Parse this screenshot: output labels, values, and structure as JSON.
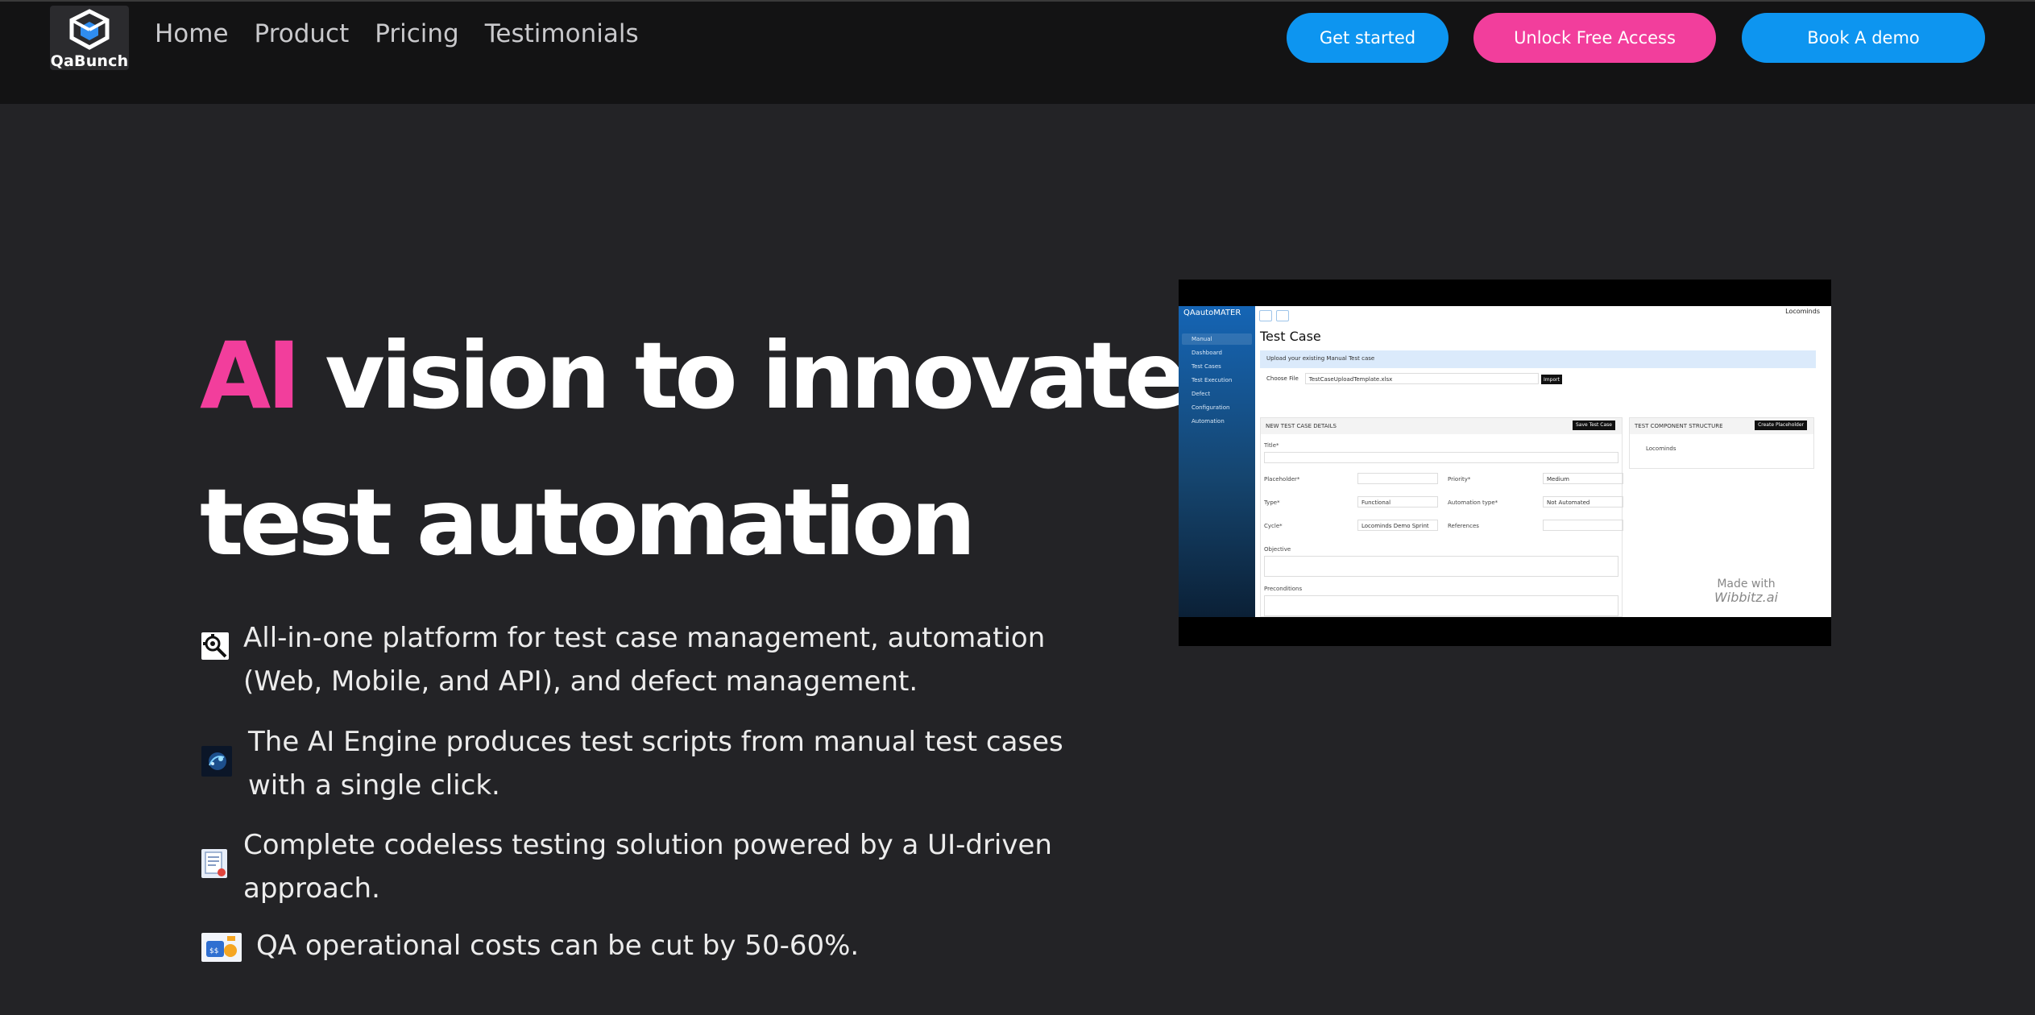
{
  "nav": {
    "logo_text": "QaBunch",
    "links": [
      "Home",
      "Product",
      "Pricing",
      "Testimonials"
    ],
    "buttons": {
      "get_started": "Get started",
      "unlock": "Unlock Free Access",
      "book_demo": "Book A demo"
    }
  },
  "hero": {
    "title_accent": "AI",
    "title_rest": " vision to innovate",
    "title_line2": "test automation"
  },
  "features": [
    {
      "icon": "gear-search-icon",
      "text": "All-in-one platform for test case management, automation (Web, Mobile, and API), and defect management."
    },
    {
      "icon": "ai-brain-icon",
      "text": "The AI Engine produces test scripts from manual test cases with a single click."
    },
    {
      "icon": "codeless-doc-icon",
      "text": "Complete codeless testing solution powered by a UI-driven approach."
    },
    {
      "icon": "cost-savings-icon",
      "text": "QA operational costs can be cut by 50-60%."
    }
  ],
  "preview": {
    "brand": "QAautoMATER",
    "user": "Locominds",
    "sidebar": [
      "Manual",
      "Dashboard",
      "Test Cases",
      "Test Execution",
      "Defect",
      "Configuration",
      "Automation"
    ],
    "page_title": "Test Case",
    "upload_label": "Upload your existing Manual Test case",
    "choose_file": "Choose File",
    "file_name": "TestCaseUploadTemplate.xlsx",
    "import": "Import",
    "details_header": "NEW TEST CASE DETAILS",
    "save": "Save Test Case",
    "component_header": "TEST COMPONENT STRUCTURE",
    "create_placeholder": "Create Placeholder",
    "component_item": "Locominds",
    "fields": {
      "title": "Title*",
      "placeholder": "Placeholder*",
      "priority": "Priority*",
      "priority_value": "Medium",
      "type": "Type*",
      "type_value": "Functional",
      "automation_type": "Automation type*",
      "automation_value": "Not Automated",
      "cycle": "Cycle*",
      "cycle_value": "Locominds Demo Sprint",
      "references": "References",
      "objective": "Objective",
      "preconditions": "Preconditions"
    },
    "made_with": "Made with",
    "made_with_brand": "Wibbitz.ai"
  },
  "colors": {
    "accent_pink": "#f23e9c",
    "accent_blue": "#0d95f0",
    "background": "#232326",
    "nav_background": "#131314"
  }
}
